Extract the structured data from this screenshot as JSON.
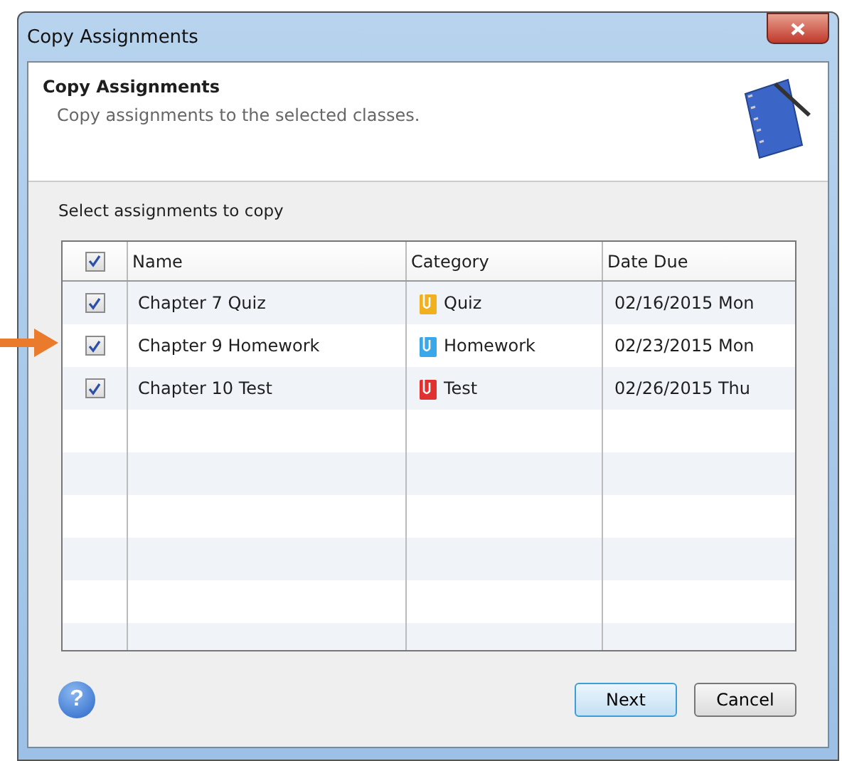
{
  "window": {
    "title": "Copy Assignments"
  },
  "header": {
    "title": "Copy Assignments",
    "subtitle": "Copy assignments to the selected classes."
  },
  "section_label": "Select assignments to copy",
  "table": {
    "all_checked": true,
    "columns": [
      "Name",
      "Category",
      "Date Due"
    ],
    "rows": [
      {
        "checked": true,
        "name": "Chapter 7 Quiz",
        "category": "Quiz",
        "color": "#f0b020",
        "date": "02/16/2015 Mon"
      },
      {
        "checked": true,
        "name": "Chapter 9 Homework",
        "category": "Homework",
        "color": "#3aa8e8",
        "date": "02/23/2015 Mon"
      },
      {
        "checked": true,
        "name": "Chapter 10 Test",
        "category": "Test",
        "color": "#e03030",
        "date": "02/26/2015 Thu"
      }
    ]
  },
  "help": "?",
  "buttons": [
    {
      "label": "Next",
      "default": true
    },
    {
      "label": "Cancel",
      "default": false
    }
  ]
}
